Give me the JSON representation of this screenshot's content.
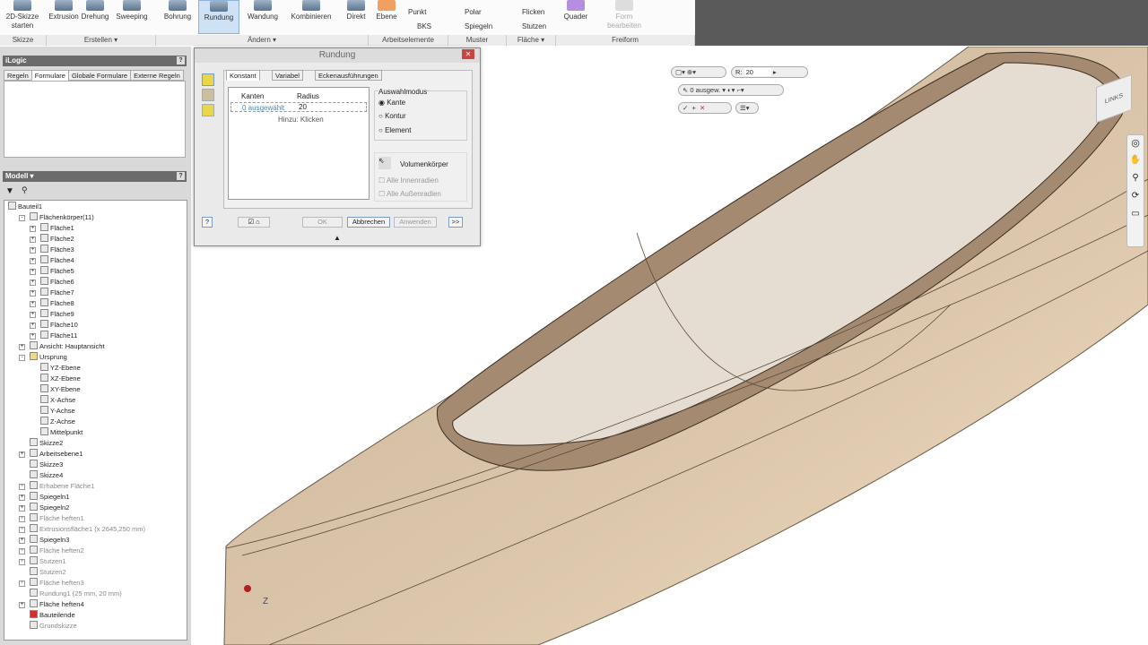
{
  "ribbon": {
    "buttons": [
      {
        "label": "2D-Skizze starten",
        "icon": "sketch-icon"
      },
      {
        "label": "Extrusion",
        "icon": "extrude-icon"
      },
      {
        "label": "Drehung",
        "icon": "revolve-icon"
      },
      {
        "label": "Sweeping",
        "icon": "sweep-icon"
      },
      {
        "label": "Bohrung",
        "icon": "hole-icon"
      },
      {
        "label": "Rundung",
        "icon": "fillet-icon",
        "selected": true
      },
      {
        "label": "Wandung",
        "icon": "shell-icon"
      },
      {
        "label": "Kombinieren",
        "icon": "combine-icon"
      },
      {
        "label": "Direkt",
        "icon": "direct-edit-icon"
      },
      {
        "label": "Ebene",
        "icon": "plane-icon"
      },
      {
        "label": "Quader",
        "icon": "box-icon"
      },
      {
        "label": "Form bearbeiten",
        "icon": "edit-form-icon",
        "disabled": true
      }
    ],
    "small_buttons": [
      "Punkt",
      "BKS",
      "Polar",
      "Spiegeln",
      "Flicken",
      "Stutzen"
    ],
    "groups": [
      "Skizze",
      "Erstellen ▾",
      "Ändern ▾",
      "Arbeitselemente",
      "Muster",
      "Fläche ▾",
      "Freiform"
    ]
  },
  "ilogic": {
    "title": "iLogic",
    "tabs": [
      "Regeln",
      "Formulare",
      "Globale Formulare",
      "Externe Regeln"
    ],
    "active_tab": "Formulare"
  },
  "model": {
    "title": "Modell ▾",
    "tree": [
      {
        "label": "Bauteil1",
        "level": 0
      },
      {
        "label": "Flächenkörper(11)",
        "level": 1,
        "exp": "-"
      },
      {
        "label": "Fläche1",
        "level": 2,
        "exp": "+"
      },
      {
        "label": "Fläche2",
        "level": 2,
        "exp": "+"
      },
      {
        "label": "Fläche3",
        "level": 2,
        "exp": "+"
      },
      {
        "label": "Fläche4",
        "level": 2,
        "exp": "+"
      },
      {
        "label": "Fläche5",
        "level": 2,
        "exp": "+"
      },
      {
        "label": "Fläche6",
        "level": 2,
        "exp": "+"
      },
      {
        "label": "Fläche7",
        "level": 2,
        "exp": "+"
      },
      {
        "label": "Fläche8",
        "level": 2,
        "exp": "+"
      },
      {
        "label": "Fläche9",
        "level": 2,
        "exp": "+"
      },
      {
        "label": "Fläche10",
        "level": 2,
        "exp": "+"
      },
      {
        "label": "Fläche11",
        "level": 2,
        "exp": "+"
      },
      {
        "label": "Ansicht: Hauptansicht",
        "level": 1,
        "exp": "+"
      },
      {
        "label": "Ursprung",
        "level": 1,
        "exp": "-"
      },
      {
        "label": "YZ-Ebene",
        "level": 2
      },
      {
        "label": "XZ-Ebene",
        "level": 2
      },
      {
        "label": "XY-Ebene",
        "level": 2
      },
      {
        "label": "X-Achse",
        "level": 2
      },
      {
        "label": "Y-Achse",
        "level": 2
      },
      {
        "label": "Z-Achse",
        "level": 2
      },
      {
        "label": "Mittelpunkt",
        "level": 2
      },
      {
        "label": "Skizze2",
        "level": 1
      },
      {
        "label": "Arbeitsebene1",
        "level": 1,
        "exp": "+"
      },
      {
        "label": "Skizze3",
        "level": 1
      },
      {
        "label": "Skizze4",
        "level": 1
      },
      {
        "label": "Erhabene Fläche1",
        "level": 1,
        "exp": "+",
        "dim": true
      },
      {
        "label": "Spiegeln1",
        "level": 1,
        "exp": "+"
      },
      {
        "label": "Spiegeln2",
        "level": 1,
        "exp": "+"
      },
      {
        "label": "Fläche heften1",
        "level": 1,
        "exp": "+",
        "dim": true
      },
      {
        "label": "Extrusionsfläche1 (x 2645,250 mm)",
        "level": 1,
        "exp": "+",
        "dim": true
      },
      {
        "label": "Spiegeln3",
        "level": 1,
        "exp": "+"
      },
      {
        "label": "Fläche heften2",
        "level": 1,
        "exp": "+",
        "dim": true
      },
      {
        "label": "Stutzen1",
        "level": 1,
        "exp": "+",
        "dim": true
      },
      {
        "label": "Stutzen2",
        "level": 1,
        "dim": true
      },
      {
        "label": "Fläche heften3",
        "level": 1,
        "exp": "+",
        "dim": true
      },
      {
        "label": "Rundung1 (25 mm, 20 mm)",
        "level": 1,
        "dim": true
      },
      {
        "label": "Fläche heften4",
        "level": 1,
        "exp": "+"
      },
      {
        "label": "Bauteilende",
        "level": 1
      },
      {
        "label": "Grundskizze",
        "level": 1,
        "dim": true
      }
    ]
  },
  "dialog": {
    "title": "Rundung",
    "tabs": [
      "Konstant",
      "Variabel",
      "Eckenausführungen"
    ],
    "col_kanten": "Kanten",
    "col_radius": "Radius",
    "row_kanten": "0 ausgewählt",
    "row_radius": "20",
    "add_hint": "Hinzu: Klicken",
    "mode_title": "Auswahlmodus",
    "modes": [
      "Kante",
      "Kontur",
      "Element"
    ],
    "selected_mode": "Kante",
    "solid": "Volumenkörper",
    "inner": "Alle Innenradien",
    "outer": "Alle Außenradien",
    "ok": "OK",
    "cancel": "Abbrechen",
    "apply": "Anwenden",
    "more": ">>"
  },
  "minitoolbar": {
    "r_label": "R:",
    "r_value": "20",
    "selected": "0 ausgew."
  },
  "viewcube": {
    "face": "LINKS"
  },
  "colors": {
    "accent": "#cfe2f5",
    "body": "#d8c2a6",
    "panel_header": "#6b6b6b"
  }
}
